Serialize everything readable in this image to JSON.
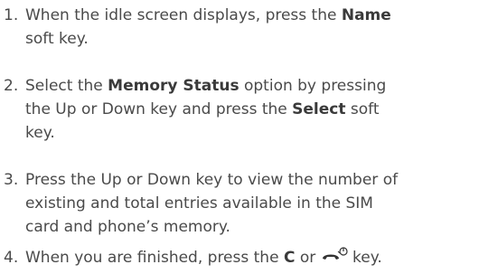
{
  "steps": [
    {
      "number": "1.",
      "parts": [
        {
          "text": "When the idle screen displays, press the "
        },
        {
          "text": "Name",
          "bold": true
        },
        {
          "text": " soft key."
        }
      ],
      "lines": [
        [
          {
            "text": "When the idle screen displays, press the "
          },
          {
            "text": "Name",
            "bold": true
          }
        ],
        [
          {
            "text": "soft key."
          }
        ]
      ]
    },
    {
      "number": "2.",
      "lines": [
        [
          {
            "text": "Select the "
          },
          {
            "text": "Memory Status",
            "bold": true
          },
          {
            "text": " option by pressing"
          }
        ],
        [
          {
            "text": "the Up or Down key and press the "
          },
          {
            "text": "Select",
            "bold": true
          },
          {
            "text": " soft"
          }
        ],
        [
          {
            "text": "key."
          }
        ]
      ]
    },
    {
      "number": "3.",
      "lines": [
        [
          {
            "text": "Press the Up or Down key to view the number of"
          }
        ],
        [
          {
            "text": "existing and total entries available in the SIM"
          }
        ],
        [
          {
            "text": "card and phone’s memory."
          }
        ]
      ]
    },
    {
      "number": "4.",
      "lines": [
        [
          {
            "text": "When you are finished, press the "
          },
          {
            "text": "C",
            "bold": true
          },
          {
            "text": " or "
          },
          {
            "icon": "end-call-power-icon"
          },
          {
            "text": " key."
          }
        ]
      ]
    }
  ]
}
